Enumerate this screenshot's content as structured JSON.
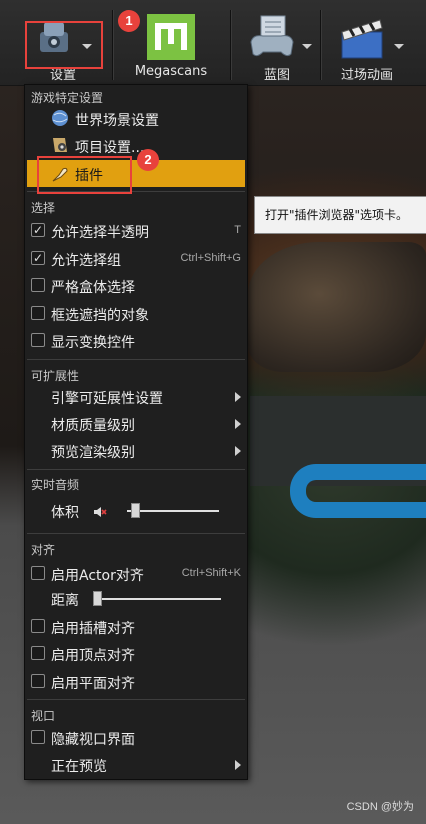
{
  "toolbar": {
    "settings_label": "设置",
    "megascans_label": "Megascans",
    "blueprint_label": "蓝图",
    "cinematics_label": "过场动画"
  },
  "annotations": {
    "badge_1": "1",
    "badge_2": "2",
    "color": "#e8423c"
  },
  "menu": {
    "game_section": {
      "title": "游戏特定设置",
      "world_settings": "世界场景设置",
      "project_settings": "项目设置....",
      "plugins": "插件"
    },
    "selection": {
      "title": "选择",
      "allow_translucent": "允许选择半透明",
      "allow_translucent_shortcut": "T",
      "allow_groups": "允许选择组",
      "allow_groups_shortcut": "Ctrl+Shift+G",
      "strict_box": "严格盒体选择",
      "box_occluded": "框选遮挡的对象",
      "show_transform": "显示变换控件"
    },
    "scalability": {
      "title": "可扩展性",
      "engine": "引擎可延展性设置",
      "material_quality": "材质质量级别",
      "preview_rendering": "预览渲染级别"
    },
    "audio": {
      "title": "实时音频",
      "volume": "体积",
      "volume_level": 0.05
    },
    "snapping": {
      "title": "对齐",
      "actor_snap": "启用Actor对齐",
      "actor_snap_shortcut": "Ctrl+Shift+K",
      "distance": "距离",
      "distance_level": 0.0,
      "socket_snap": "启用插槽对齐",
      "vertex_snap": "启用顶点对齐",
      "plane_snap": "启用平面对齐"
    },
    "viewport": {
      "title": "视口",
      "hide_ui": "隐藏视口界面",
      "previewing": "正在预览"
    }
  },
  "tooltip": "打开\"插件浏览器\"选项卡。",
  "watermark": "CSDN @妙为",
  "colors": {
    "highlight": "#e1a010",
    "menu_bg": "#1f1f1f"
  }
}
